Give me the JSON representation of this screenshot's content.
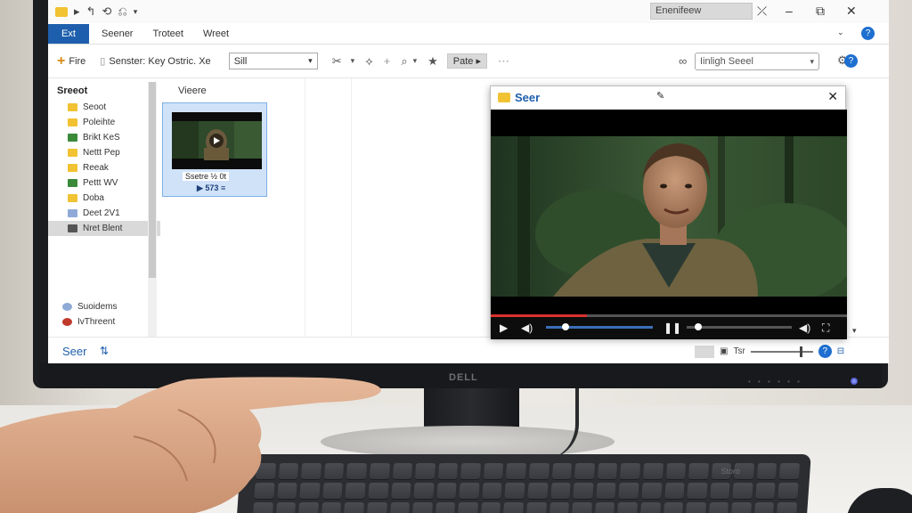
{
  "explorer": {
    "quick_access": [
      "▸",
      "↰",
      "⟲",
      "⎌"
    ],
    "window_title_box": "Enenifeew",
    "tabs": {
      "file": "Ext",
      "t1": "Seener",
      "t2": "Troteet",
      "t3": "Wreet"
    },
    "toolbar": {
      "new_label": "Fire",
      "path_label": "Senster: Key Ostric. Xe",
      "combo_value": "Sill",
      "paste_label": "Pate",
      "search_value": "Iinligh Seeel"
    },
    "nav": {
      "header": "Sreeot",
      "items": [
        {
          "label": "Seoot",
          "color": "#f1c232"
        },
        {
          "label": "Poleihte",
          "color": "#f1c232"
        },
        {
          "label": "Brikt KeS",
          "color": "#3a8a3a"
        },
        {
          "label": "Nettt Pep",
          "color": "#f1c232"
        },
        {
          "label": "Reeak",
          "color": "#f1c232"
        },
        {
          "label": "Pettt WV",
          "color": "#3a8a3a"
        },
        {
          "label": "Doba",
          "color": "#f1c232"
        },
        {
          "label": "Deet 2V1",
          "color": "#8faad6"
        },
        {
          "label": "Nret Blent",
          "color": "#555555"
        }
      ],
      "bottom_items": [
        {
          "label": "Suoidems",
          "color": "#8faad6"
        },
        {
          "label": "IvThreent",
          "color": "#c0392b"
        }
      ]
    },
    "content": {
      "column_header": "Vieere",
      "tile_label": "Ssetre ½ 0t",
      "tile_meta": "▶ 573 ≡"
    },
    "status": {
      "left": "Seer",
      "right_label": "Tsr"
    }
  },
  "player": {
    "title": "Seer",
    "progress_fraction": 0.27,
    "volume_fraction": 0.15,
    "seek_fraction": 0.08
  },
  "monitor_brand": "DELL",
  "keyboard_label": "Storo",
  "colors": {
    "accent": "#1e5fad",
    "progress": "#d8322e",
    "volume": "#3a6fb7"
  }
}
